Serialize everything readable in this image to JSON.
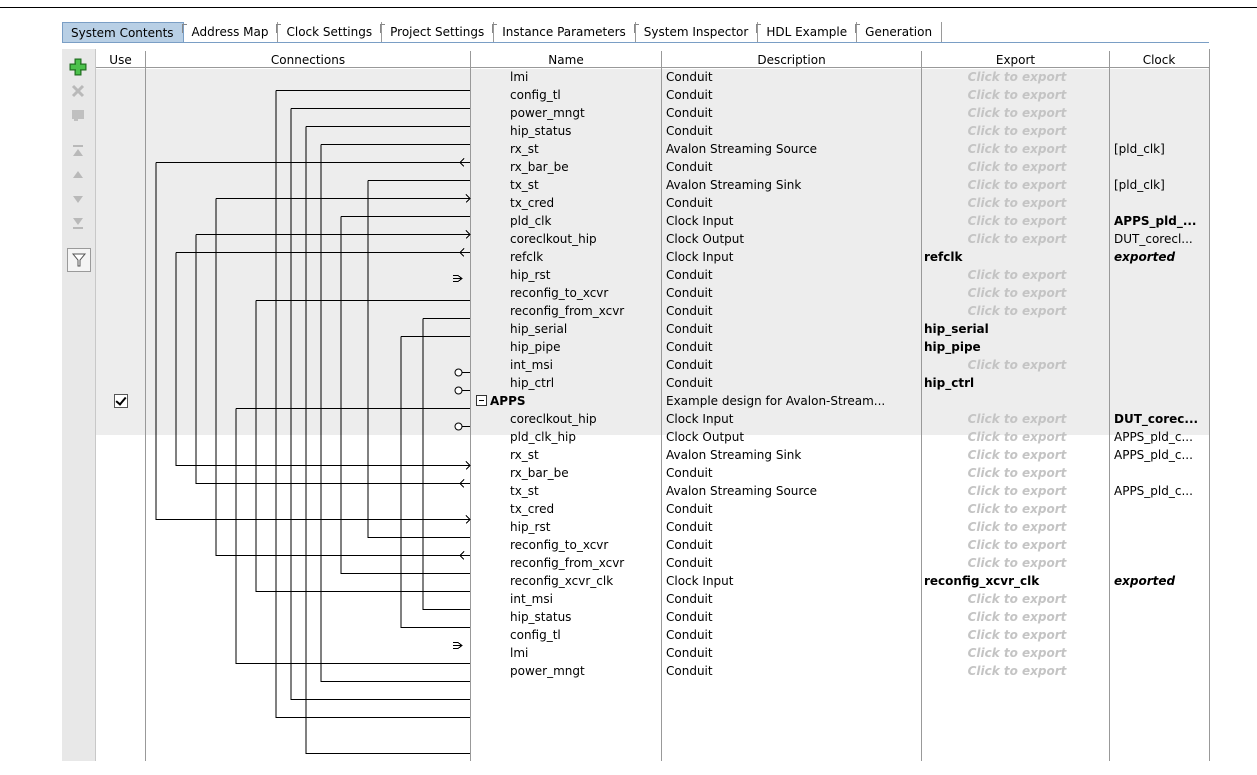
{
  "tabs": [
    {
      "label": "System Contents",
      "active": true
    },
    {
      "label": "Address Map",
      "active": false
    },
    {
      "label": "Clock Settings",
      "active": false
    },
    {
      "label": "Project Settings",
      "active": false
    },
    {
      "label": "Instance Parameters",
      "active": false
    },
    {
      "label": "System Inspector",
      "active": false
    },
    {
      "label": "HDL Example",
      "active": false
    },
    {
      "label": "Generation",
      "active": false
    }
  ],
  "toolbar": {
    "add_icon": "plus-icon",
    "remove_icon": "x-icon",
    "edit_icon": "edit-icon",
    "move_top_icon": "move-top-icon",
    "move_up_icon": "move-up-icon",
    "move_down_icon": "move-down-icon",
    "move_bottom_icon": "move-bottom-icon",
    "filter_icon": "filter-icon"
  },
  "headers": {
    "use": "Use",
    "connections": "Connections",
    "name": "Name",
    "description": "Description",
    "export": "Export",
    "clock": "Clock"
  },
  "rows": [
    {
      "name": "lmi",
      "desc": "Conduit",
      "export": "Click to export",
      "clock": ""
    },
    {
      "name": "config_tl",
      "desc": "Conduit",
      "export": "Click to export",
      "clock": ""
    },
    {
      "name": "power_mngt",
      "desc": "Conduit",
      "export": "Click to export",
      "clock": ""
    },
    {
      "name": "hip_status",
      "desc": "Conduit",
      "export": "Click to export",
      "clock": ""
    },
    {
      "name": "rx_st",
      "desc": "Avalon Streaming Source",
      "export": "Click to export",
      "clock": "[pld_clk]"
    },
    {
      "name": "rx_bar_be",
      "desc": "Conduit",
      "export": "Click to export",
      "clock": ""
    },
    {
      "name": "tx_st",
      "desc": "Avalon Streaming Sink",
      "export": "Click to export",
      "clock": "[pld_clk]"
    },
    {
      "name": "tx_cred",
      "desc": "Conduit",
      "export": "Click to export",
      "clock": ""
    },
    {
      "name": "pld_clk",
      "desc": "Clock Input",
      "export": "Click to export",
      "clock": "APPS_pld_...",
      "clock_style": "bold"
    },
    {
      "name": "coreclkout_hip",
      "desc": "Clock Output",
      "export": "Click to export",
      "clock": "DUT_corecl..."
    },
    {
      "name": "refclk",
      "desc": "Clock Input",
      "export": "refclk",
      "export_exported": true,
      "clock": "exported",
      "clock_style": "boldit"
    },
    {
      "name": "hip_rst",
      "desc": "Conduit",
      "export": "Click to export",
      "clock": ""
    },
    {
      "name": "reconfig_to_xcvr",
      "desc": "Conduit",
      "export": "Click to export",
      "clock": ""
    },
    {
      "name": "reconfig_from_xcvr",
      "desc": "Conduit",
      "export": "Click to export",
      "clock": ""
    },
    {
      "name": "hip_serial",
      "desc": "Conduit",
      "export": "hip_serial",
      "export_exported": true,
      "clock": ""
    },
    {
      "name": "hip_pipe",
      "desc": "Conduit",
      "export": "hip_pipe",
      "export_exported": true,
      "clock": ""
    },
    {
      "name": "int_msi",
      "desc": "Conduit",
      "export": "Click to export",
      "clock": ""
    },
    {
      "name": "hip_ctrl",
      "desc": "Conduit",
      "export": "hip_ctrl",
      "export_exported": true,
      "clock": ""
    },
    {
      "name": "APPS",
      "desc": "Example design for Avalon-Stream...",
      "export": "",
      "clock": "",
      "component": true,
      "checked": true
    },
    {
      "name": "coreclkout_hip",
      "desc": "Clock Input",
      "export": "Click to export",
      "clock": "DUT_corec...",
      "clock_style": "bold"
    },
    {
      "name": "pld_clk_hip",
      "desc": "Clock Output",
      "export": "Click to export",
      "clock": "APPS_pld_c..."
    },
    {
      "name": "rx_st",
      "desc": "Avalon Streaming Sink",
      "export": "Click to export",
      "clock": "APPS_pld_c..."
    },
    {
      "name": "rx_bar_be",
      "desc": "Conduit",
      "export": "Click to export",
      "clock": ""
    },
    {
      "name": "tx_st",
      "desc": "Avalon Streaming Source",
      "export": "Click to export",
      "clock": "APPS_pld_c..."
    },
    {
      "name": "tx_cred",
      "desc": "Conduit",
      "export": "Click to export",
      "clock": ""
    },
    {
      "name": "hip_rst",
      "desc": "Conduit",
      "export": "Click to export",
      "clock": ""
    },
    {
      "name": "reconfig_to_xcvr",
      "desc": "Conduit",
      "export": "Click to export",
      "clock": ""
    },
    {
      "name": "reconfig_from_xcvr",
      "desc": "Conduit",
      "export": "Click to export",
      "clock": ""
    },
    {
      "name": "reconfig_xcvr_clk",
      "desc": "Clock Input",
      "export": "reconfig_xcvr_clk",
      "export_exported": true,
      "clock": "exported",
      "clock_style": "boldit"
    },
    {
      "name": "int_msi",
      "desc": "Conduit",
      "export": "Click to export",
      "clock": ""
    },
    {
      "name": "hip_status",
      "desc": "Conduit",
      "export": "Click to export",
      "clock": ""
    },
    {
      "name": "config_tl",
      "desc": "Conduit",
      "export": "Click to export",
      "clock": ""
    },
    {
      "name": "lmi",
      "desc": "Conduit",
      "export": "Click to export",
      "clock": ""
    },
    {
      "name": "power_mngt",
      "desc": "Conduit",
      "export": "Click to export",
      "clock": ""
    }
  ],
  "colors": {
    "active_tab": "#b8cfe5",
    "dut_band": "#ededed",
    "click_to_export": "#c4c4c4"
  }
}
